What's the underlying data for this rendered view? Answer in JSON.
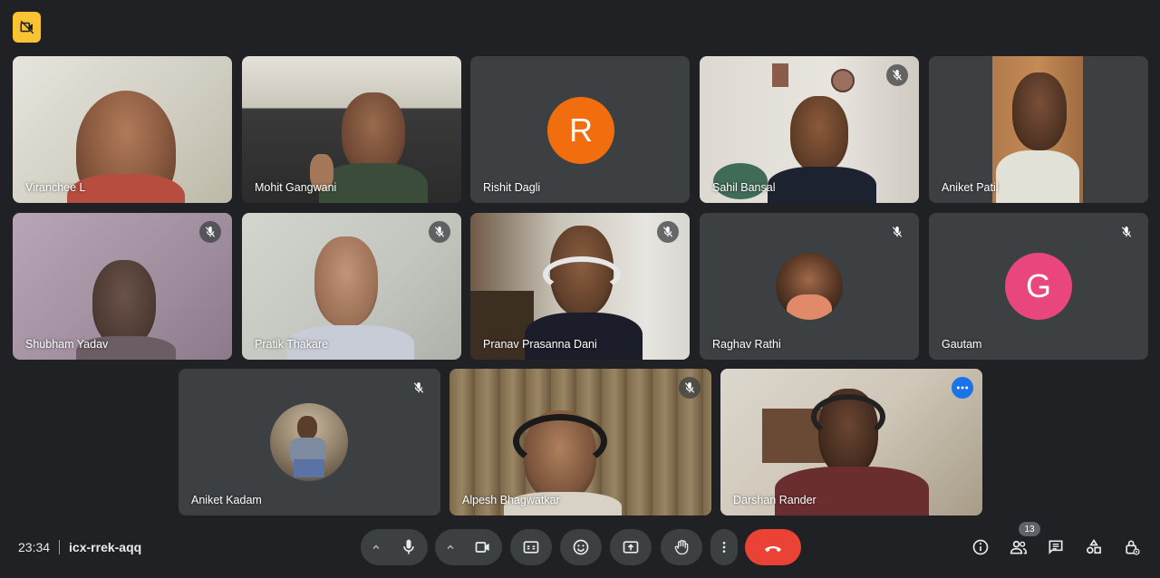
{
  "participants": [
    {
      "name": "Viranchee L"
    },
    {
      "name": "Mohit Gangwani"
    },
    {
      "name": "Rishit Dagli",
      "initial": "R",
      "color": "#f16d0d"
    },
    {
      "name": "Sahil Bansal"
    },
    {
      "name": "Aniket Patil"
    },
    {
      "name": "Shubham Yadav"
    },
    {
      "name": "Pratik Thakare"
    },
    {
      "name": "Pranav Prasanna Dani"
    },
    {
      "name": "Raghav Rathi"
    },
    {
      "name": "Gautam",
      "initial": "G",
      "color": "#e8467c"
    },
    {
      "name": "Aniket Kadam"
    },
    {
      "name": "Alpesh Bhagwatkar"
    },
    {
      "name": "Darshan Rander"
    }
  ],
  "meeting": {
    "time": "23:34",
    "code": "icx-rrek-aqq",
    "participant_count": "13"
  },
  "colors": {
    "background": "#202124",
    "tile": "#3c4043",
    "active_border": "#8ab4f8",
    "end_call": "#ea4335",
    "badge": "#f9c333"
  },
  "icons": {
    "top_badge": "camera-off-icon",
    "mute": "mic-off-icon",
    "controls": [
      "mic-icon",
      "camera-icon",
      "captions-icon",
      "emoji-icon",
      "present-icon",
      "raise-hand-icon",
      "more-vert-icon",
      "end-call-icon"
    ],
    "right": [
      "info-icon",
      "people-icon",
      "chat-icon",
      "activities-icon",
      "host-controls-icon"
    ]
  }
}
